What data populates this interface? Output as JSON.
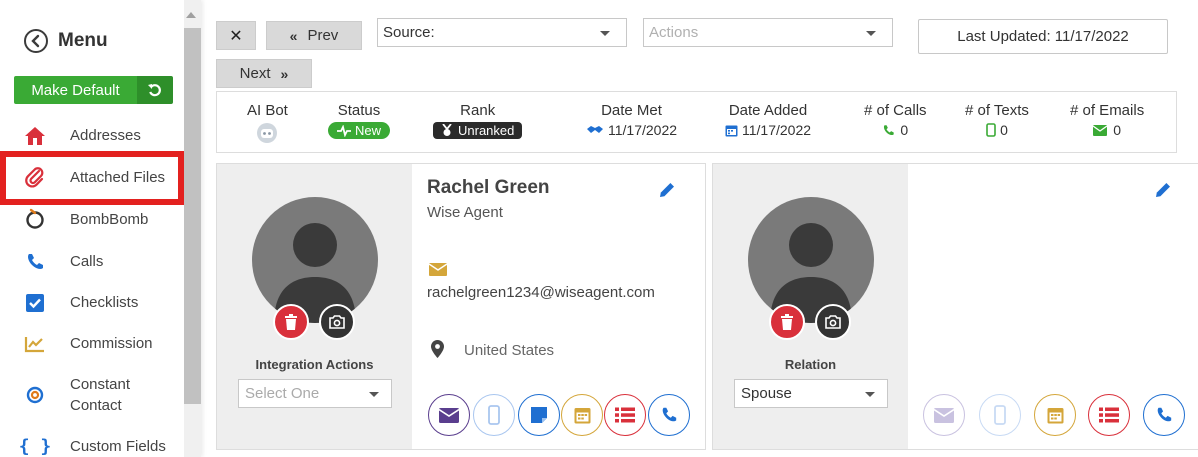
{
  "sidebar": {
    "title": "Menu",
    "make_default_label": "Make Default",
    "items": [
      {
        "label": "Addresses",
        "icon": "house-icon"
      },
      {
        "label": "Attached Files",
        "icon": "paperclip-icon"
      },
      {
        "label": "BombBomb",
        "icon": "bombbomb-icon"
      },
      {
        "label": "Calls",
        "icon": "phone-icon"
      },
      {
        "label": "Checklists",
        "icon": "checkbox-icon"
      },
      {
        "label": "Commission",
        "icon": "chart-line-icon"
      },
      {
        "label": "Constant Contact",
        "icon": "constant-contact-icon"
      },
      {
        "label": "Custom Fields",
        "icon": "braces-icon"
      }
    ]
  },
  "toolbar": {
    "close_label": "✕",
    "prev_label": "Prev",
    "next_label": "Next",
    "source_label": "Source:",
    "actions_placeholder": "Actions",
    "last_updated": "Last Updated: 11/17/2022"
  },
  "stats": {
    "ai_bot": {
      "header": "AI Bot"
    },
    "status": {
      "header": "Status",
      "value": "New"
    },
    "rank": {
      "header": "Rank",
      "value": "Unranked"
    },
    "date_met": {
      "header": "Date Met",
      "value": "11/17/2022"
    },
    "date_added": {
      "header": "Date Added",
      "value": "11/17/2022"
    },
    "calls": {
      "header": "# of Calls",
      "value": "0"
    },
    "texts": {
      "header": "# of Texts",
      "value": "0"
    },
    "emails": {
      "header": "# of Emails",
      "value": "0"
    }
  },
  "contact_card": {
    "name": "Rachel Green",
    "company": "Wise Agent",
    "email": "rachelgreen1234@wiseagent.com",
    "country": "United States",
    "integration_label": "Integration Actions",
    "integration_placeholder": "Select One"
  },
  "relation_card": {
    "relation_label": "Relation",
    "relation_value": "Spouse"
  },
  "colors": {
    "green": "#3aaa35",
    "red": "#d9303b",
    "blue": "#1f6fd1",
    "purple": "#5a3e8e",
    "gold": "#d4a63a",
    "highlight": "#e3211f"
  }
}
